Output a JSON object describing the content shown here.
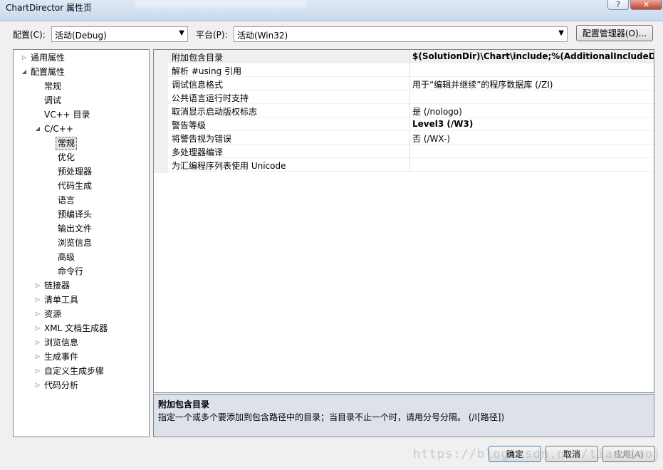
{
  "window": {
    "title": "ChartDirector 属性页",
    "help_label": "?",
    "close_label": "✕"
  },
  "config": {
    "config_label": "配置(C):",
    "config_value": "活动(Debug)",
    "platform_label": "平台(P):",
    "platform_value": "活动(Win32)",
    "manager_button": "配置管理器(O)..."
  },
  "tree": {
    "items": [
      {
        "label": "通用属性",
        "arrow": "collapsed"
      },
      {
        "label": "配置属性",
        "arrow": "expanded"
      },
      {
        "label": "常规",
        "arrow": "none"
      },
      {
        "label": "调试",
        "arrow": "none"
      },
      {
        "label": "VC++ 目录",
        "arrow": "none"
      },
      {
        "label": "C/C++",
        "arrow": "expanded"
      },
      {
        "label": "常规",
        "arrow": "none",
        "selected": true
      },
      {
        "label": "优化",
        "arrow": "none"
      },
      {
        "label": "预处理器",
        "arrow": "none"
      },
      {
        "label": "代码生成",
        "arrow": "none"
      },
      {
        "label": "语言",
        "arrow": "none"
      },
      {
        "label": "预编译头",
        "arrow": "none"
      },
      {
        "label": "输出文件",
        "arrow": "none"
      },
      {
        "label": "浏览信息",
        "arrow": "none"
      },
      {
        "label": "高级",
        "arrow": "none"
      },
      {
        "label": "命令行",
        "arrow": "none"
      },
      {
        "label": "链接器",
        "arrow": "collapsed"
      },
      {
        "label": "清单工具",
        "arrow": "collapsed"
      },
      {
        "label": "资源",
        "arrow": "collapsed"
      },
      {
        "label": "XML 文档生成器",
        "arrow": "collapsed"
      },
      {
        "label": "浏览信息",
        "arrow": "collapsed"
      },
      {
        "label": "生成事件",
        "arrow": "collapsed"
      },
      {
        "label": "自定义生成步骤",
        "arrow": "collapsed"
      },
      {
        "label": "代码分析",
        "arrow": "collapsed"
      }
    ]
  },
  "properties": [
    {
      "name": "附加包含目录",
      "value": "$(SolutionDir)\\Chart\\include;%(AdditionalIncludeDirectori",
      "bold": true
    },
    {
      "name": "解析 #using 引用",
      "value": "",
      "bold": false
    },
    {
      "name": "调试信息格式",
      "value": "用于“编辑并继续”的程序数据库 (/ZI)",
      "bold": false
    },
    {
      "name": "公共语言运行时支持",
      "value": "",
      "bold": false
    },
    {
      "name": "取消显示启动版权标志",
      "value": "是 (/nologo)",
      "bold": false
    },
    {
      "name": "警告等级",
      "value": "Level3 (/W3)",
      "bold": true
    },
    {
      "name": "将警告视为错误",
      "value": "否 (/WX-)",
      "bold": false
    },
    {
      "name": "多处理器编译",
      "value": "",
      "bold": false
    },
    {
      "name": "为汇编程序列表使用 Unicode",
      "value": "",
      "bold": false
    }
  ],
  "description": {
    "title": "附加包含目录",
    "text": "指定一个或多个要添加到包含路径中的目录；当目录不止一个时，请用分号分隔。    (/I[路径])"
  },
  "buttons": {
    "ok": "确定",
    "cancel": "取消",
    "apply": "应用(A)"
  },
  "watermark": "https://blog.csdn.net/tianxiaojiang"
}
